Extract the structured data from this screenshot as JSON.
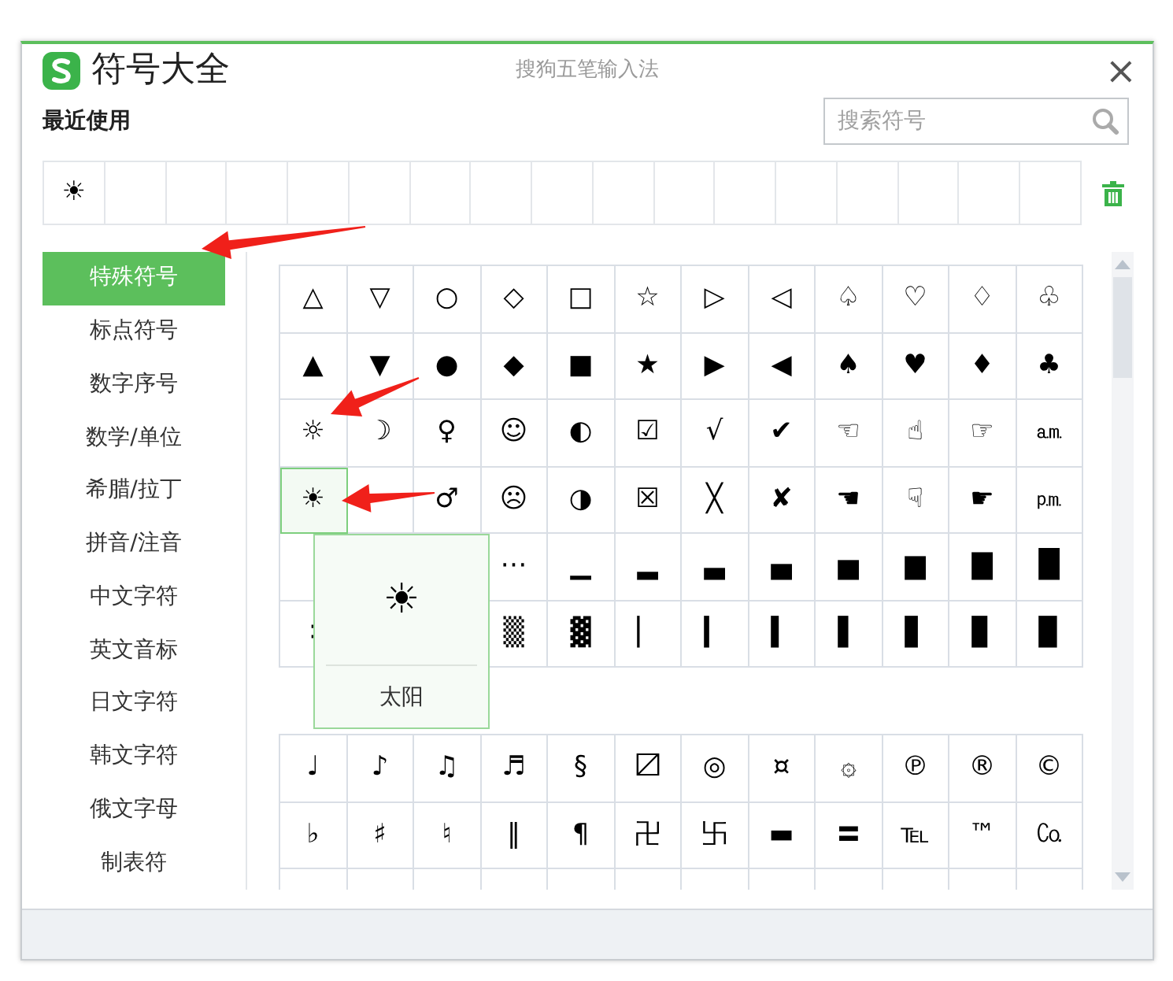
{
  "window": {
    "title": "符号大全",
    "app_name": "搜狗五笔输入法",
    "close": "×"
  },
  "recent": {
    "label": "最近使用",
    "items": [
      "☀"
    ]
  },
  "search": {
    "placeholder": "搜索符号"
  },
  "categories": [
    {
      "label": "特殊符号",
      "selected": true
    },
    {
      "label": "标点符号",
      "selected": false
    },
    {
      "label": "数字序号",
      "selected": false
    },
    {
      "label": "数学/单位",
      "selected": false
    },
    {
      "label": "希腊/拉丁",
      "selected": false
    },
    {
      "label": "拼音/注音",
      "selected": false
    },
    {
      "label": "中文字符",
      "selected": false
    },
    {
      "label": "英文音标",
      "selected": false
    },
    {
      "label": "日文字符",
      "selected": false
    },
    {
      "label": "韩文字符",
      "selected": false
    },
    {
      "label": "俄文字母",
      "selected": false
    },
    {
      "label": "制表符",
      "selected": false
    }
  ],
  "symbol_grid": {
    "rows": [
      [
        {
          "symbol": "△",
          "selected": false
        },
        {
          "symbol": "▽",
          "selected": false
        },
        {
          "symbol": "○",
          "selected": false
        },
        {
          "symbol": "◇",
          "selected": false
        },
        {
          "symbol": "□",
          "selected": false
        },
        {
          "symbol": "☆",
          "selected": false
        },
        {
          "symbol": "▷",
          "selected": false
        },
        {
          "symbol": "◁",
          "selected": false
        },
        {
          "symbol": "♤",
          "selected": false
        },
        {
          "symbol": "♡",
          "selected": false
        },
        {
          "symbol": "♢",
          "selected": false
        },
        {
          "symbol": "♧",
          "selected": false
        }
      ],
      [
        {
          "symbol": "▲",
          "selected": false
        },
        {
          "symbol": "▼",
          "selected": false
        },
        {
          "symbol": "●",
          "selected": false
        },
        {
          "symbol": "◆",
          "selected": false
        },
        {
          "symbol": "■",
          "selected": false
        },
        {
          "symbol": "★",
          "selected": false
        },
        {
          "symbol": "▶",
          "selected": false
        },
        {
          "symbol": "◀",
          "selected": false
        },
        {
          "symbol": "♠",
          "selected": false
        },
        {
          "symbol": "♥",
          "selected": false
        },
        {
          "symbol": "♦",
          "selected": false
        },
        {
          "symbol": "♣",
          "selected": false
        }
      ],
      [
        {
          "symbol": "☼",
          "selected": false
        },
        {
          "symbol": "☽",
          "selected": false
        },
        {
          "symbol": "♀",
          "selected": false
        },
        {
          "symbol": "☺",
          "selected": false
        },
        {
          "symbol": "◐",
          "selected": false
        },
        {
          "symbol": "☑",
          "selected": false
        },
        {
          "symbol": "√",
          "selected": false
        },
        {
          "symbol": "✔",
          "selected": false
        },
        {
          "symbol": "☜",
          "selected": false
        },
        {
          "symbol": "☝",
          "selected": false
        },
        {
          "symbol": "☞",
          "selected": false
        },
        {
          "symbol": "㏂",
          "selected": false
        }
      ],
      [
        {
          "symbol": "☀",
          "selected": true
        },
        {
          "selected": false
        },
        {
          "symbol": "♂",
          "selected": false
        },
        {
          "symbol": "☹",
          "selected": false
        },
        {
          "symbol": "◑",
          "selected": false
        },
        {
          "symbol": "☒",
          "selected": false
        },
        {
          "symbol": "╳",
          "selected": false
        },
        {
          "symbol": "✘",
          "selected": false
        },
        {
          "symbol": "☚",
          "selected": false
        },
        {
          "symbol": "☟",
          "selected": false
        },
        {
          "symbol": "☛",
          "selected": false
        },
        {
          "symbol": "㏘",
          "selected": false
        }
      ],
      [
        null,
        null,
        null,
        {
          "symbol": "⋯",
          "selected": false
        },
        {
          "symbol": "▁",
          "selected": false
        },
        {
          "symbol": "▂",
          "selected": false
        },
        {
          "symbol": "▃",
          "selected": false
        },
        {
          "symbol": "▄",
          "selected": false
        },
        {
          "symbol": "▅",
          "selected": false
        },
        {
          "symbol": "▆",
          "selected": false
        },
        {
          "symbol": "▇",
          "selected": false
        },
        {
          "symbol": "█",
          "selected": false
        }
      ],
      [
        {
          "symbol": "∶",
          "selected": false
        },
        null,
        null,
        {
          "symbol": "▒",
          "selected": false
        },
        {
          "symbol": "▓",
          "selected": false
        },
        {
          "symbol": "▏",
          "selected": false
        },
        {
          "symbol": "▎",
          "selected": false
        },
        {
          "symbol": "▍",
          "selected": false
        },
        {
          "symbol": "▌",
          "selected": false
        },
        {
          "symbol": "▋",
          "selected": false
        },
        {
          "symbol": "▊",
          "selected": false
        },
        {
          "symbol": "▉",
          "selected": false
        }
      ]
    ]
  },
  "tooltip": {
    "symbol": "☀",
    "name": "太阳"
  },
  "symbol_grid_2": {
    "rows": [
      [
        {
          "symbol": "♩",
          "selected": false
        },
        {
          "symbol": "♪",
          "selected": false
        },
        {
          "symbol": "♫",
          "selected": false
        },
        {
          "symbol": "♬",
          "selected": false
        },
        {
          "symbol": "§",
          "selected": false
        },
        {
          "symbol": "〼",
          "selected": false
        },
        {
          "symbol": "◎",
          "selected": false
        },
        {
          "symbol": "¤",
          "selected": false
        },
        {
          "symbol": "۞",
          "selected": false
        },
        {
          "symbol": "℗",
          "selected": false
        },
        {
          "symbol": "®",
          "selected": false
        },
        {
          "symbol": "©",
          "selected": false
        }
      ],
      [
        {
          "symbol": "♭",
          "selected": false
        },
        {
          "symbol": "♯",
          "selected": false
        },
        {
          "symbol": "♮",
          "selected": false
        },
        {
          "symbol": "‖",
          "selected": false
        },
        {
          "symbol": "¶",
          "selected": false
        },
        {
          "symbol": "卍",
          "selected": false
        },
        {
          "symbol": "卐",
          "selected": false
        },
        {
          "symbol": "▬",
          "selected": false
        },
        {
          "symbol": "〓",
          "selected": false
        },
        {
          "symbol": "℡",
          "selected": false
        },
        {
          "symbol": "™",
          "selected": false
        },
        {
          "symbol": "㏇",
          "selected": false
        }
      ]
    ]
  }
}
